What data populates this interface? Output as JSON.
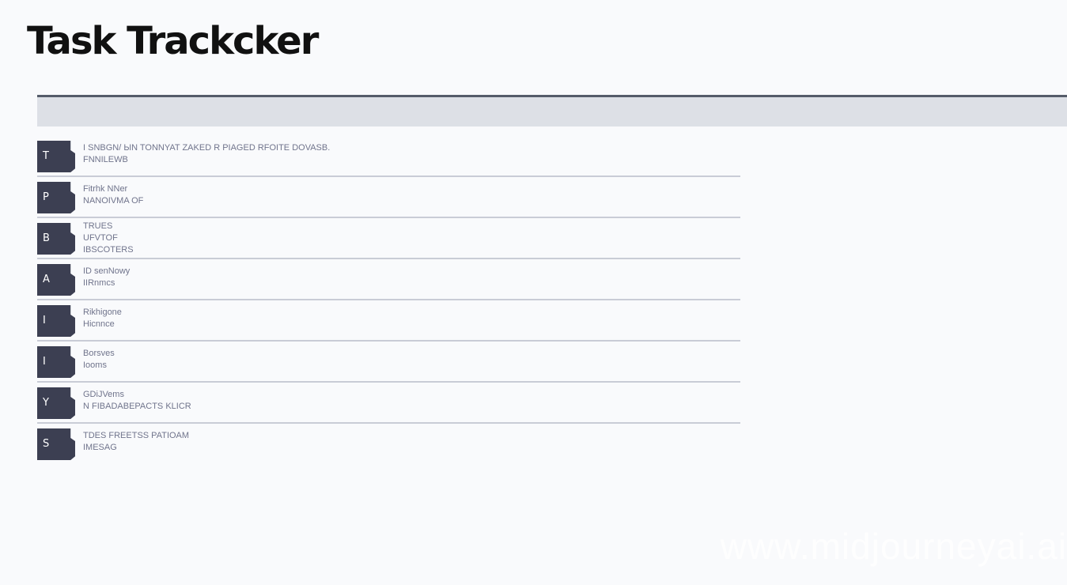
{
  "app": {
    "title": "Task Trackcker"
  },
  "tasks": [
    {
      "badge": "T",
      "line1": "I SNBGN/ ЫN TONNYAT ZAKED R PIAGED RFOITE DOVASB.",
      "line2": "FNNILEWB"
    },
    {
      "badge": "P",
      "line1": "Fitrhk NNer",
      "line2": "NANOIVMA OF"
    },
    {
      "badge": "B",
      "line1": "TRUES",
      "line2": "UFVTOF",
      "line3": "IBSCOTERS"
    },
    {
      "badge": "A",
      "line1": "ID senNowy",
      "line2": "IIRnmcs"
    },
    {
      "badge": "I",
      "line1": "Rikhigone",
      "line2": "Hicnnce"
    },
    {
      "badge": "I",
      "line1": "Borsves",
      "line2": "Iooms"
    },
    {
      "badge": "Y",
      "line1": "GDiJVems",
      "line2": "N FIBADABEPACTS KLICR"
    },
    {
      "badge": "S",
      "line1": "TDES FREETSS PATIOAM",
      "line2": "IMESAG"
    }
  ],
  "watermark": "www.midjourneyai.ai"
}
